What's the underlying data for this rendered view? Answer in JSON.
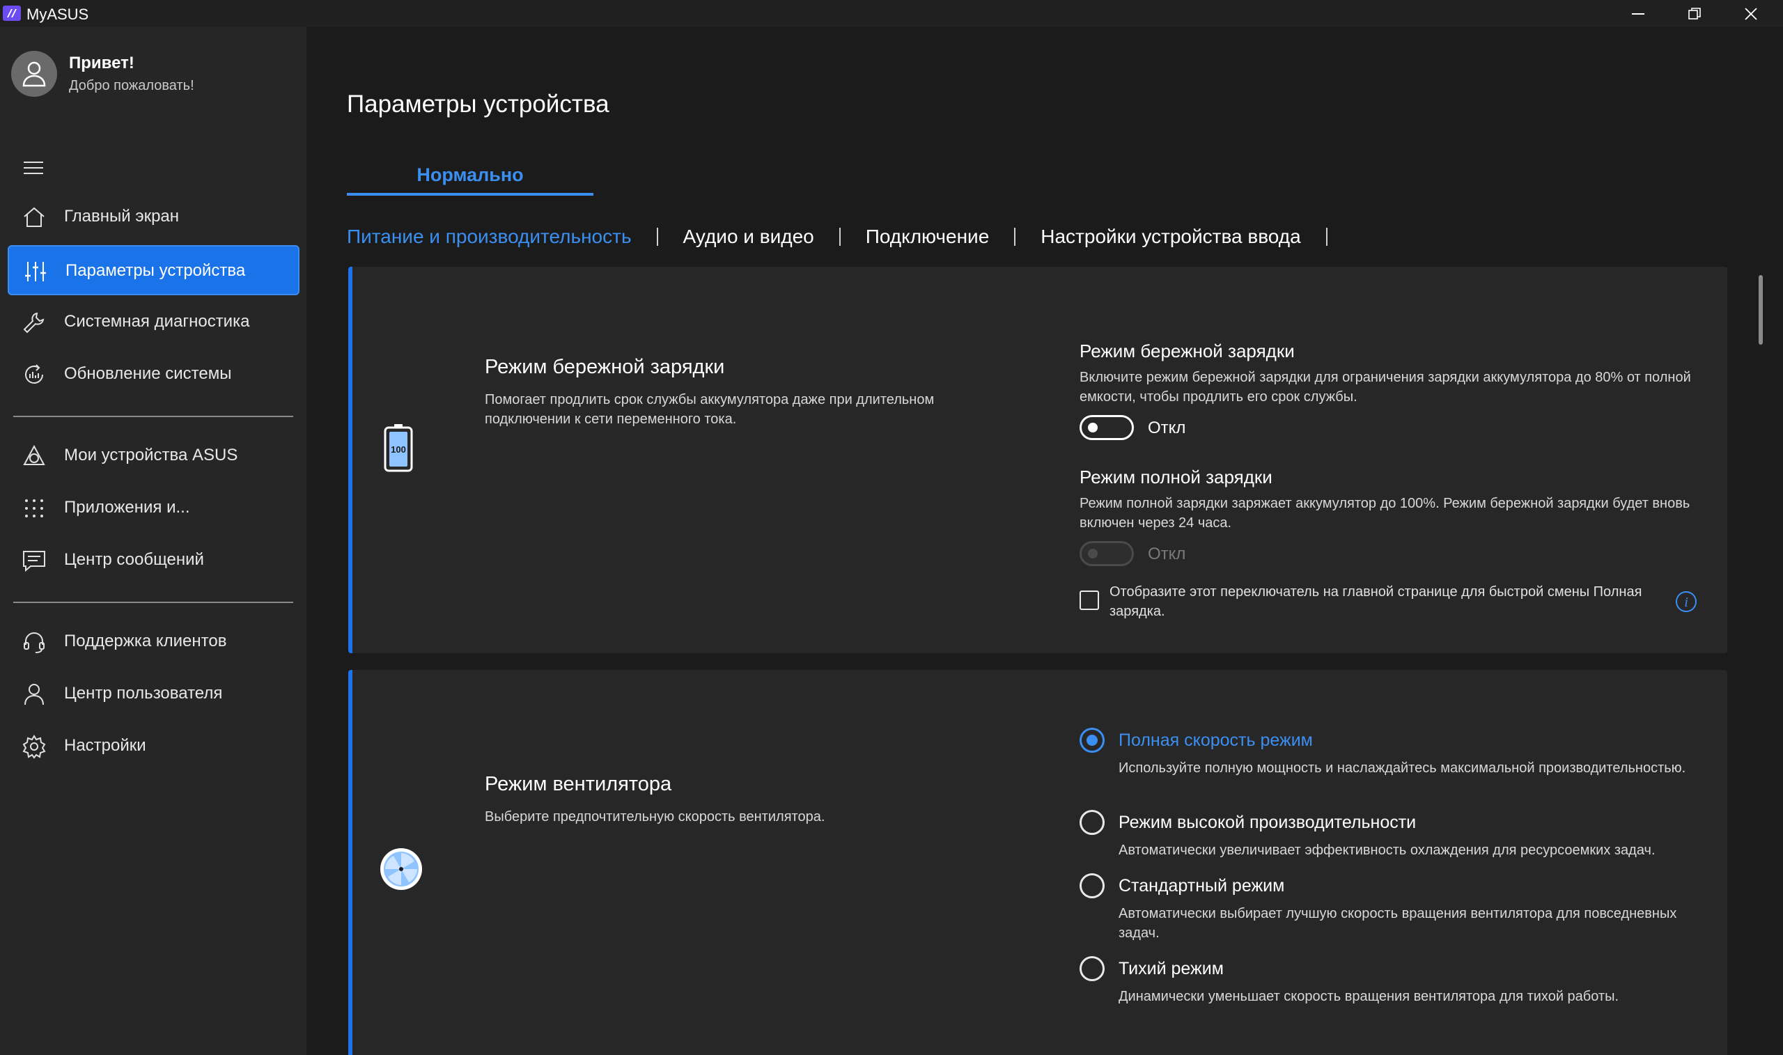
{
  "window": {
    "title": "MyASUS",
    "minimize_icon": "minimize-icon",
    "maximize_icon": "restore-icon",
    "close_icon": "close-icon"
  },
  "sidebar": {
    "greeting": "Привет!",
    "welcome": "Добро пожаловать!",
    "items": [
      {
        "label": "Главный экран",
        "icon": "home-icon"
      },
      {
        "label": "Параметры устройства",
        "icon": "sliders-icon",
        "active": true
      },
      {
        "label": "Системная диагностика",
        "icon": "wrench-icon"
      },
      {
        "label": "Обновление системы",
        "icon": "update-icon"
      },
      {
        "label": "Мои устройства ASUS",
        "icon": "devices-icon"
      },
      {
        "label": "Приложения и...",
        "icon": "apps-grid-icon"
      },
      {
        "label": "Центр сообщений",
        "icon": "message-icon"
      },
      {
        "label": "Поддержка клиентов",
        "icon": "headset-icon"
      },
      {
        "label": "Центр пользователя",
        "icon": "user-icon"
      },
      {
        "label": "Настройки",
        "icon": "gear-icon"
      }
    ]
  },
  "main": {
    "title": "Параметры устройства",
    "mode_tab": "Нормально",
    "subtabs": [
      "Питание и производительность",
      "Аудио и видео",
      "Подключение",
      "Настройки устройства ввода"
    ],
    "battery_card": {
      "title": "Режим бережной зарядки",
      "description": "Помогает продлить срок службы аккумулятора даже при длительном подключении к сети переменного тока.",
      "battery_level": "100",
      "care_title": "Режим бережной зарядки",
      "care_desc": "Включите режим бережной зарядки для ограничения зарядки аккумулятора до 80% от полной емкости, чтобы продлить его срок службы.",
      "care_state": "Откл",
      "full_title": "Режим полной зарядки",
      "full_desc": "Режим полной зарядки заряжает аккумулятор до 100%. Режим бережной зарядки будет вновь включен через 24 часа.",
      "full_state": "Откл",
      "checkbox_text": "Отобразите этот переключатель на главной странице для быстрой смены Полная зарядка."
    },
    "fan_card": {
      "title": "Режим вентилятора",
      "description": "Выберите предпочтительную скорость вентилятора.",
      "options": [
        {
          "label": "Полная скорость режим",
          "desc": "Используйте полную мощность и наслаждайтесь максимальной производительностью.",
          "selected": true
        },
        {
          "label": "Режим высокой производительности",
          "desc": "Автоматически увеличивает эффективность охлаждения для ресурсоемких задач."
        },
        {
          "label": "Стандартный режим",
          "desc": "Автоматически выбирает лучшую скорость вращения вентилятора для повседневных задач."
        },
        {
          "label": "Тихий режим",
          "desc": "Динамически уменьшает скорость вращения вентилятора для тихой работы."
        }
      ]
    }
  },
  "colors": {
    "accent": "#1a73e8",
    "accent_text": "#3b8ff0",
    "sidebar_bg": "#262626",
    "main_bg": "#1b1b1b",
    "card_bg": "#272727"
  }
}
